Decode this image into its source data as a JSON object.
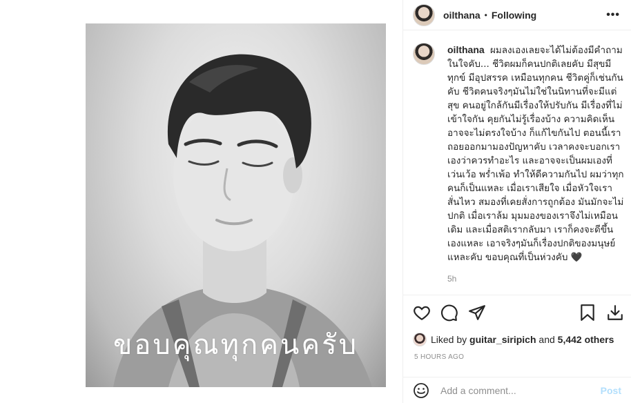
{
  "post": {
    "image_caption": "ขอบคุณทุกคนครับ"
  },
  "header": {
    "username": "oilthana",
    "separator": "•",
    "follow_status": "Following",
    "more_glyph": "•••"
  },
  "caption": {
    "username": "oilthana",
    "text": "ผมลงเองเลยจะได้ไม่ต้องมีคำถามในใจคับ... ชีวิตผมก็คนปกติเลยคับ มีสุขมีทุกข์ มีอุปสรรค เหมือนทุกคน ชีวิตคู่ก็เช่นกันคับ ชีวิตคนจริงๆมันไม่ใช่ในนิทานที่จะมีแต่สุข คนอยู่ใกล้กันมีเรื่องให้ปรับกัน มีเรื่องที่ไม่เข้าใจกัน คุยกันไม่รู้เรื่องบ้าง ความคิดเห็นอาจจะไม่ตรงใจบ้าง ก็แก้ไขกันไป ตอนนี้เราถอยออกมามองปัญหาคับ เวลาคงจะบอกเราเองว่าควรทำอะไร และอาจจะเป็นผมเองที่เว่นเว้อ พร่ำเพ้อ ทำให้ดีความกันไป ผมว่าทุกคนก็เป็นแหละ เมื่อเราเสียใจ เมื่อหัวใจเราสั่นไหว สมองที่เคยสั่งการถูกต้อง มันมักจะไม่ปกติ เมื่อเราล้ม มุมมองของเราจึงไม่เหมือนเดิม และเมื่อสติเรากลับมา เราก็คงจะดีขึ้นเองแหละ เอาจริงๆมันก็เรื่องปกติของมนุษย์แหละคับ ขอบคุณที่เป็นห่วงคับ 🖤",
    "time": "5h"
  },
  "likes": {
    "prefix": "Liked by",
    "user": "guitar_siripich",
    "joiner": "and",
    "others": "5,442 others"
  },
  "posted_time": "5 HOURS AGO",
  "comment_box": {
    "placeholder": "Add a comment...",
    "post_label": "Post"
  },
  "icons": [
    "heart-icon",
    "comment-icon",
    "share-icon",
    "bookmark-icon",
    "download-icon",
    "emoji-icon",
    "more-icon"
  ]
}
